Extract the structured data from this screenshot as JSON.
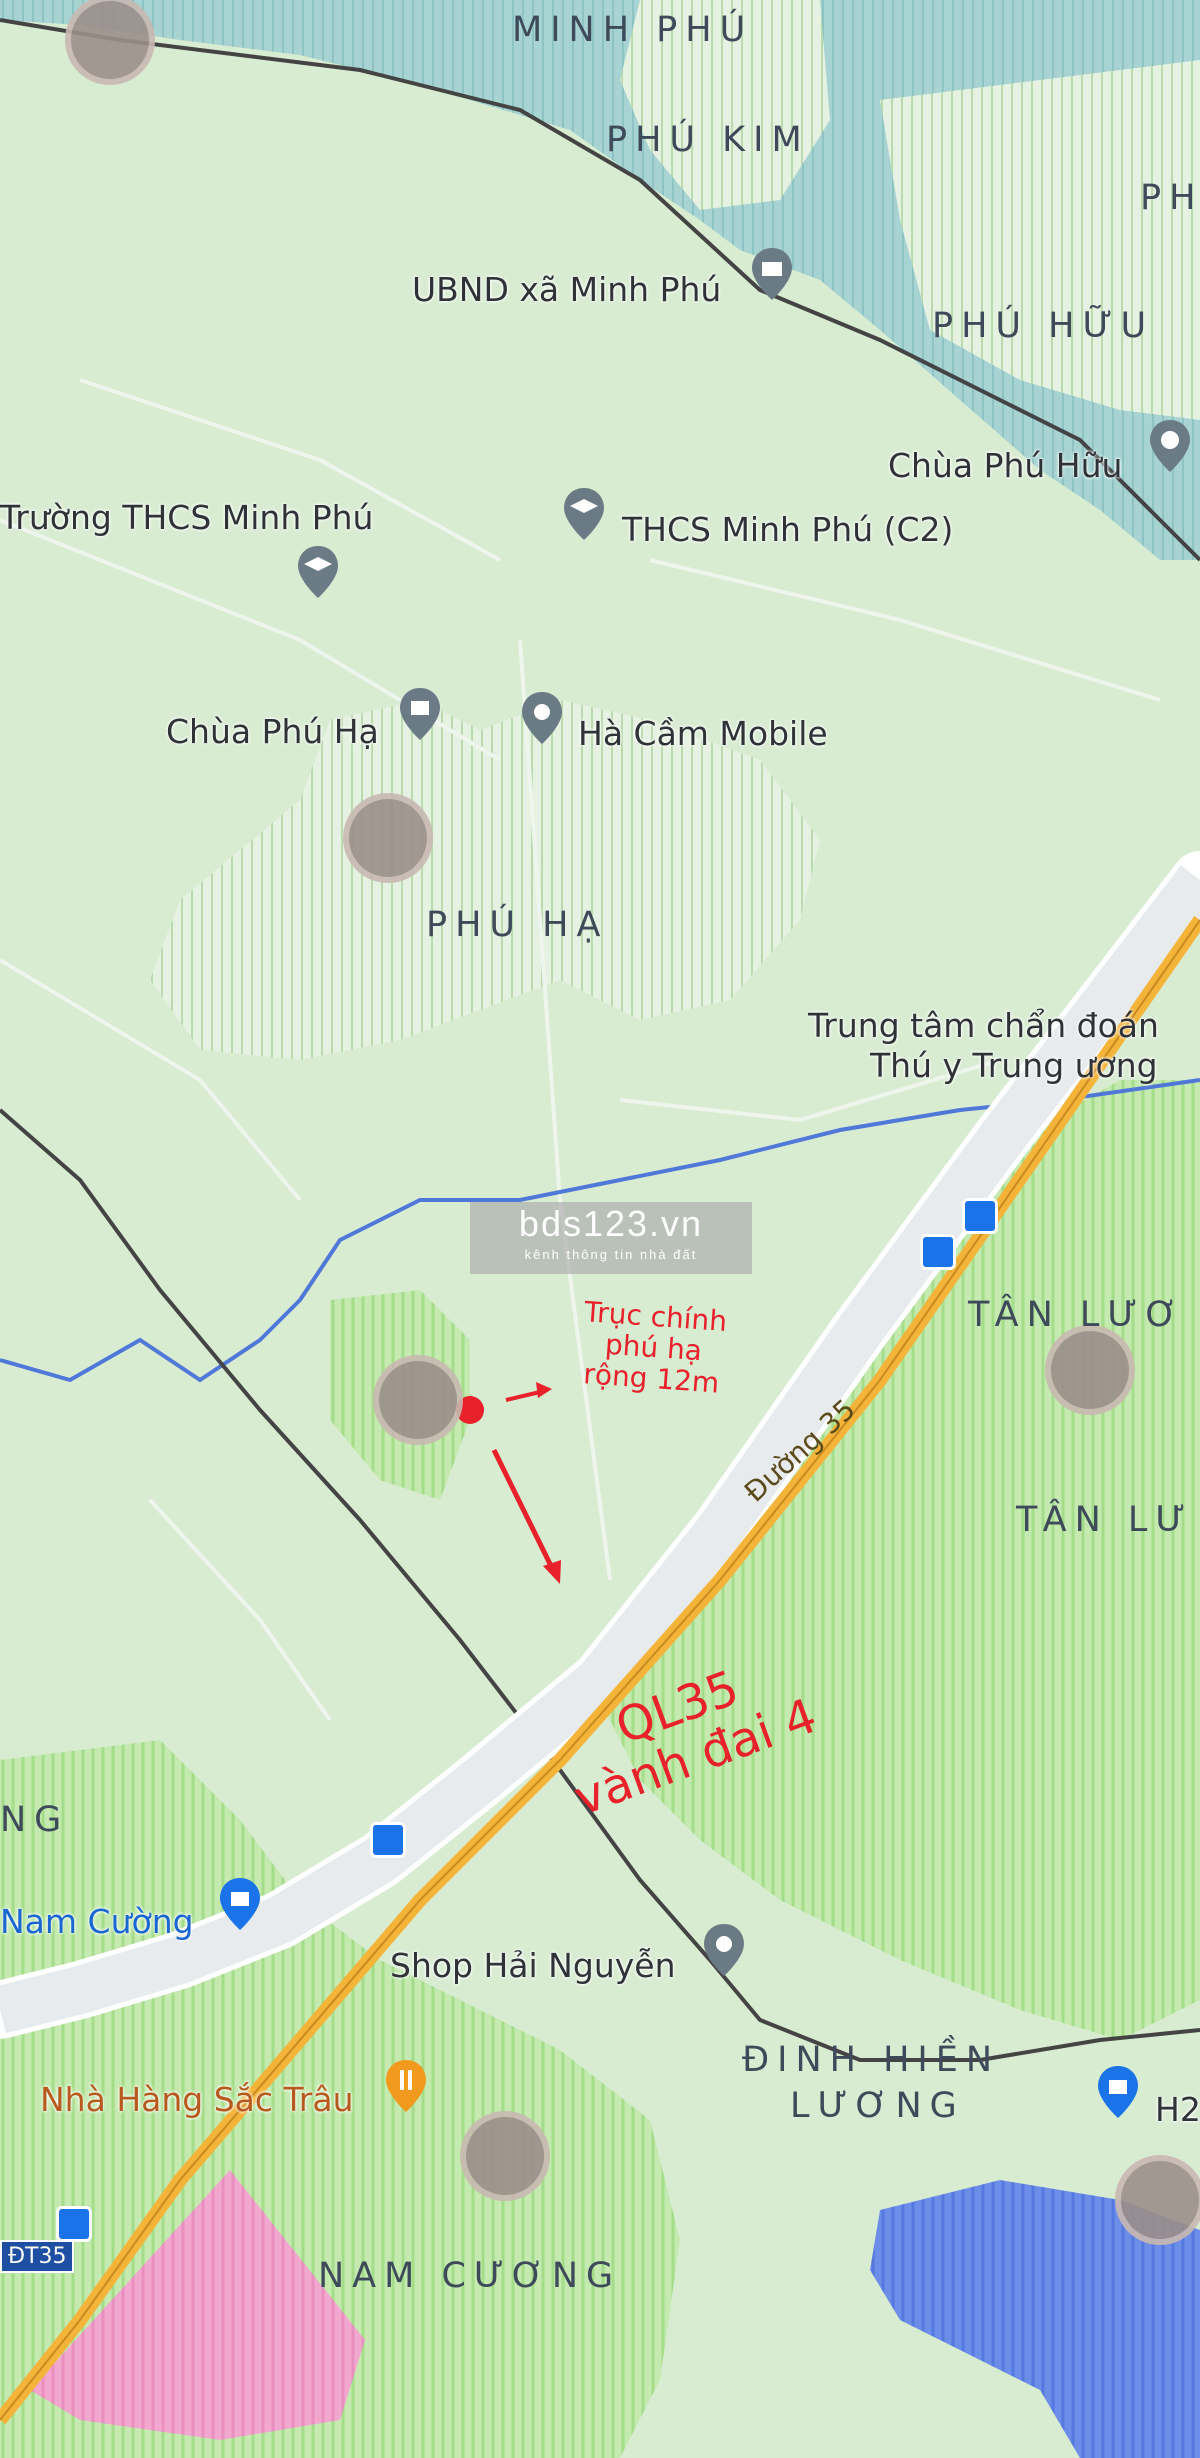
{
  "map": {
    "areas": {
      "minh_phu": "MINH PHÚ",
      "phu_kim": "PHÚ KIM",
      "phu_huu": "PHÚ HỮU",
      "phu_huu_cut": "PH",
      "phu_ha": "PHÚ HẠ",
      "tan_luong_1": "TÂN LƯƠ",
      "tan_luong_2": "TÂN LƯ",
      "ng_cut": "NG",
      "dinh_hien_1": "ĐINH HIỀN",
      "dinh_hien_2": "LƯƠNG",
      "nam_cuong": "NAM CƯƠNG"
    },
    "pois": {
      "ubnd": "UBND xã Minh Phú",
      "chua_phu_huu": "Chùa Phú Hữu",
      "truong_thcs": "Trường THCS Minh Phú",
      "thcs_c2": "THCS Minh Phú (C2)",
      "chua_phu_ha": "Chùa Phú Hạ",
      "ha_cam": "Hà Cầm Mobile",
      "trung_tam_1": "Trung tâm chẩn đoán",
      "trung_tam_2": "Thú y Trung ương",
      "nam_cuong_shop": "Nam Cường",
      "shop_hai": "Shop Hải Nguyễn",
      "nha_hang": "Nhà Hàng Sắc Trâu",
      "h2": "H2"
    },
    "roads": {
      "duong35": "Đường 35",
      "dt35": "ĐT35"
    },
    "annotations": {
      "truc_line1": "Trục chính",
      "truc_line2": "phú hạ",
      "truc_line3": "rộng 12m",
      "ql35_line1": "QL35",
      "ql35_line2": "vành đai 4"
    },
    "watermark": {
      "title": "bds123.vn",
      "subtitle": "kênh thông tin nhà đất"
    },
    "colors": {
      "land": "#d8ecd2",
      "water": "#9fcfd0",
      "urban": "#eef5ec",
      "highway": "#f4b43a",
      "annotation": "#e8212b"
    }
  }
}
